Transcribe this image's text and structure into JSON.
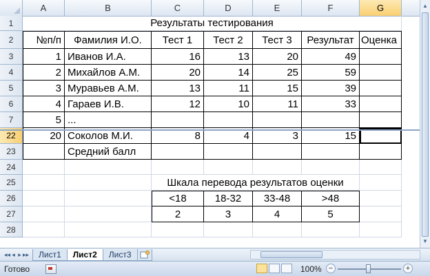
{
  "columns": [
    "A",
    "B",
    "C",
    "D",
    "E",
    "F",
    "G"
  ],
  "selected_column": "G",
  "rows": [
    {
      "num": "1",
      "cells": {
        "title": "Результаты тестирования"
      }
    },
    {
      "num": "2",
      "cells": [
        "№п/п",
        "Фамилия И.О.",
        "Тест 1",
        "Тест 2",
        "Тест 3",
        "Результат",
        "Оценка"
      ]
    },
    {
      "num": "3",
      "cells": [
        "1",
        "Иванов И.А.",
        "16",
        "13",
        "20",
        "49",
        ""
      ]
    },
    {
      "num": "4",
      "cells": [
        "2",
        "Михайлов А.М.",
        "20",
        "14",
        "25",
        "59",
        ""
      ]
    },
    {
      "num": "5",
      "cells": [
        "3",
        "Муравьев А.М.",
        "13",
        "11",
        "15",
        "39",
        ""
      ]
    },
    {
      "num": "6",
      "cells": [
        "4",
        "Гараев И.В.",
        "12",
        "10",
        "11",
        "33",
        ""
      ]
    },
    {
      "num": "7",
      "cells": [
        "5",
        "...",
        "",
        "",
        "",
        "",
        ""
      ]
    },
    {
      "num": "22",
      "cells": [
        "20",
        "Соколов М.И.",
        "8",
        "4",
        "3",
        "15",
        ""
      ]
    },
    {
      "num": "23",
      "cells": [
        "",
        "Средний балл",
        "",
        "",
        "",
        "",
        ""
      ]
    },
    {
      "num": "24",
      "cells": []
    },
    {
      "num": "25",
      "cells": {
        "title": "Шкала перевода результатов оценки"
      }
    },
    {
      "num": "26",
      "cells": [
        "<18",
        "18-32",
        "33-48",
        ">48"
      ]
    },
    {
      "num": "27",
      "cells": [
        "2",
        "3",
        "4",
        "5"
      ]
    },
    {
      "num": "28",
      "cells": []
    }
  ],
  "selected_row": "22",
  "sheet_tabs": [
    "Лист1",
    "Лист2",
    "Лист3"
  ],
  "active_tab": "Лист2",
  "status": {
    "ready": "Готово",
    "zoom": "100%",
    "zoom_minus": "−",
    "zoom_plus": "+"
  },
  "nav_buttons": [
    "◂◂",
    "◂",
    "▸",
    "▸▸"
  ]
}
